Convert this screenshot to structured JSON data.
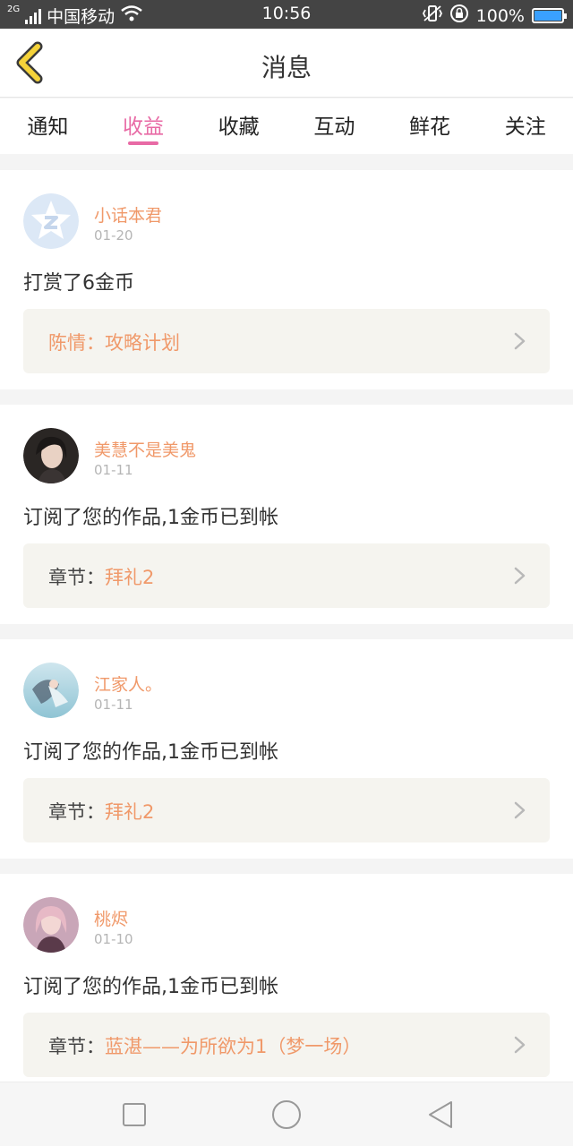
{
  "status_bar": {
    "network": "2G",
    "carrier": "中国移动",
    "time": "10:56",
    "battery": "100%",
    "battery_level": 1.0,
    "icons": [
      "signal-icon",
      "wifi-icon",
      "vibrate-icon",
      "rotation-lock-icon",
      "battery-icon"
    ]
  },
  "header": {
    "title": "消息",
    "back_icon": "chevron-left-icon"
  },
  "tabs": [
    {
      "label": "通知",
      "active": false
    },
    {
      "label": "收益",
      "active": true
    },
    {
      "label": "收藏",
      "active": false
    },
    {
      "label": "互动",
      "active": false
    },
    {
      "label": "鲜花",
      "active": false
    },
    {
      "label": "关注",
      "active": false
    }
  ],
  "messages": [
    {
      "user": "小话本君",
      "date": "01-20",
      "text": "打赏了6金币",
      "ref_label": "",
      "ref_value": "陈情：攻略计划",
      "avatar": "app-logo-avatar"
    },
    {
      "user": "美慧不是美鬼",
      "date": "01-11",
      "text": "订阅了您的作品,1金币已到帐",
      "ref_label": "章节：",
      "ref_value": "拜礼2",
      "avatar": "photo-avatar"
    },
    {
      "user": "江家人。",
      "date": "01-11",
      "text": "订阅了您的作品,1金币已到帐",
      "ref_label": "章节：",
      "ref_value": "拜礼2",
      "avatar": "illustration-avatar"
    },
    {
      "user": "桃烬",
      "date": "01-10",
      "text": "订阅了您的作品,1金币已到帐",
      "ref_label": "章节：",
      "ref_value": "蓝湛——为所欲为1（梦一场）",
      "avatar": "photo-avatar"
    }
  ],
  "nav_bar": {
    "buttons": [
      "recent-apps-icon",
      "home-icon",
      "back-triangle-icon"
    ]
  },
  "colors": {
    "accent_pink": "#e86aa5",
    "name_orange": "#f0996a",
    "back_yellow": "#f5d33a",
    "status_bar_bg": "#444444",
    "battery_blue": "#3aa0ff"
  }
}
